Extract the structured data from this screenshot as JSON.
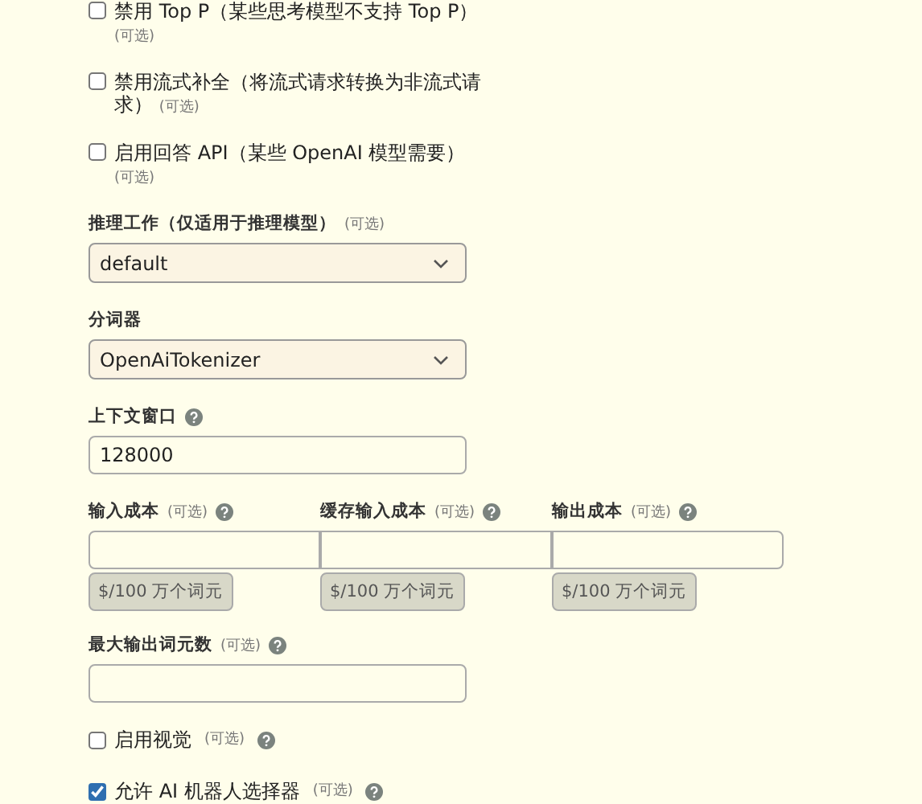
{
  "checkboxes_top": [
    {
      "label": "禁用 Top P（某些思考模型不支持 Top P）",
      "note": "(可选)",
      "checked": false
    },
    {
      "label": "禁用流式补全（将流式请求转换为非流式请求）",
      "note": "(可选)",
      "checked": false
    },
    {
      "label": "启用回答 API（某些 OpenAI 模型需要）",
      "note": "(可选)",
      "checked": false
    }
  ],
  "reasoning_effort": {
    "label": "推理工作（仅适用于推理模型）",
    "note": "(可选)",
    "value": "default"
  },
  "tokenizer": {
    "label": "分词器",
    "value": "OpenAiTokenizer"
  },
  "context_window": {
    "label": "上下文窗口",
    "help": true,
    "value": "128000"
  },
  "costs": [
    {
      "label": "输入成本",
      "note": "(可选)",
      "help": true,
      "unit": "$/100 万个词元"
    },
    {
      "label": "缓存输入成本",
      "note": "(可选)",
      "help": true,
      "unit": "$/100 万个词元"
    },
    {
      "label": "输出成本",
      "note": "(可选)",
      "help": true,
      "unit": "$/100 万个词元"
    }
  ],
  "max_output_tokens": {
    "label": "最大输出词元数",
    "note": "(可选)",
    "help": true
  },
  "checkboxes_bottom": [
    {
      "label": "启用视觉",
      "note": "(可选)",
      "help": true,
      "checked": false
    },
    {
      "label": "允许 AI 机器人选择器",
      "note": "(可选)",
      "help": true,
      "checked": true
    }
  ]
}
